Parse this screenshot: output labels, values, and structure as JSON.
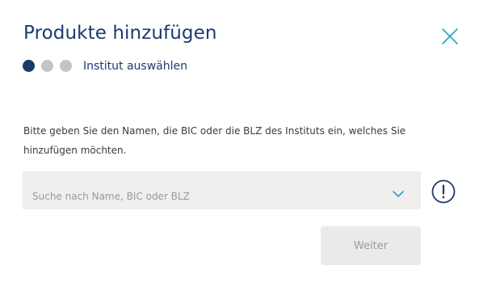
{
  "dialog": {
    "title": "Produkte hinzufügen",
    "close_icon": "close-icon"
  },
  "stepper": {
    "total_steps": 3,
    "current_step": 1,
    "current_label": "Institut auswählen"
  },
  "instruction": "Bitte geben Sie den Namen, die BIC oder die BLZ des Instituts ein, welches Sie hinzufügen möchten.",
  "search": {
    "value": "",
    "placeholder": "Suche nach Name, BIC oder BLZ",
    "icon": "chevron-down-icon"
  },
  "info": {
    "icon": "exclamation-circle-icon"
  },
  "actions": {
    "next_label": "Weiter",
    "next_enabled": false
  },
  "colors": {
    "primary": "#1b3b6f",
    "accent": "#2aa3c9",
    "inactive_dot": "#c4c4c4",
    "field_bg": "#f0efed",
    "button_disabled_bg": "#ebeae8",
    "button_disabled_text": "#9b9b9b"
  }
}
